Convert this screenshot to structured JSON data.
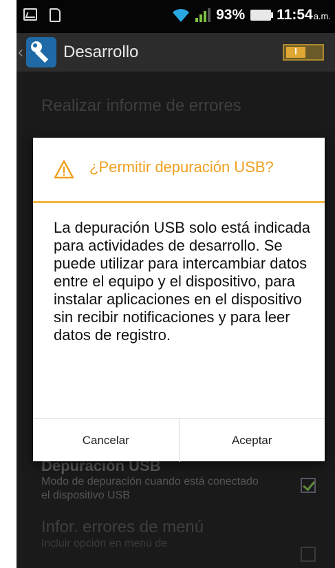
{
  "status_bar": {
    "battery": "93%",
    "time": "11:54",
    "ampm": "a.m."
  },
  "action_bar": {
    "title": "Desarrollo",
    "toggle_state": "I"
  },
  "settings": [
    {
      "title": "Realizar informe de errores"
    },
    {
      "title": "Depuración USB",
      "subtitle": "Modo de depuración cuando está conectado el dispositivo USB",
      "checked": true
    },
    {
      "title": "Infor. errores de menú",
      "subtitle": "Incluir opción en menú de",
      "checked": false
    }
  ],
  "dialog": {
    "title": "¿Permitir depuración USB?",
    "message": "La depuración USB solo está indicada para actividades de desarrollo. Se puede utilizar para intercambiar datos entre el equipo y el dispositivo, para instalar aplicaciones en el dispositivo sin recibir notificaciones y para leer datos de registro.",
    "cancel_label": "Cancelar",
    "accept_label": "Aceptar"
  },
  "colors": {
    "accent": "#f0a020",
    "divider": "#f3b53a"
  }
}
